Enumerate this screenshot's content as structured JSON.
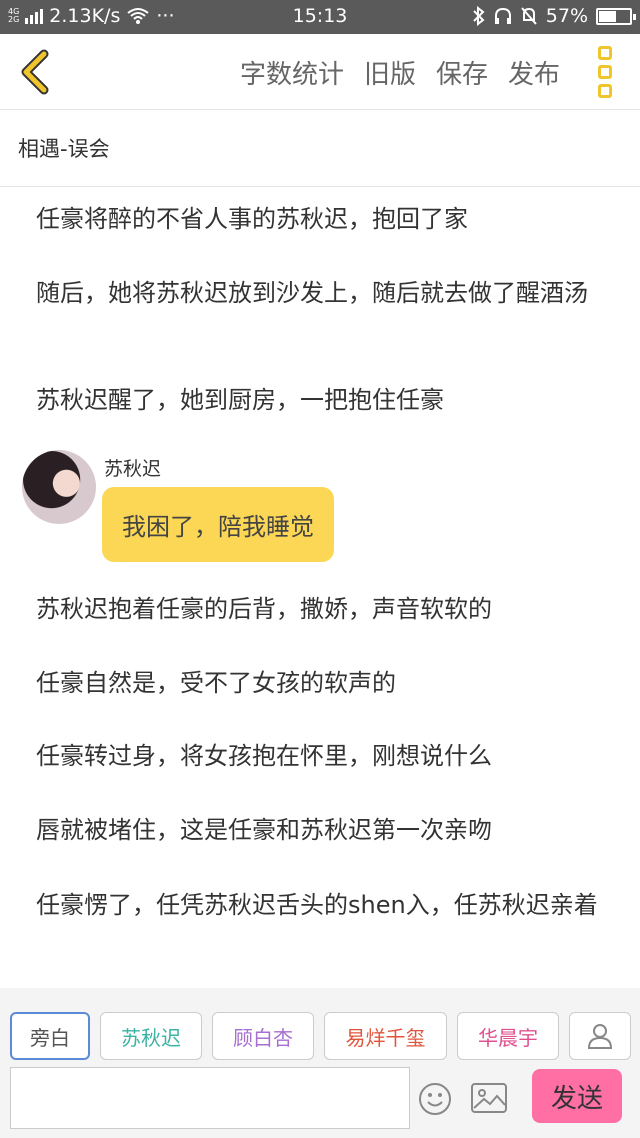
{
  "status": {
    "net_top": "4G",
    "net_bottom": "2G",
    "speed": "2.13K/s",
    "dots": "···",
    "time": "15:13",
    "battery": "57%",
    "battery_level": 0.57
  },
  "nav": {
    "word_count": "字数统计",
    "old_version": "旧版",
    "save": "保存",
    "publish": "发布"
  },
  "chapter_title": "相遇-误会",
  "content": {
    "p1": "任豪将醉的不省人事的苏秋迟，抱回了家",
    "p2": "随后，她将苏秋迟放到沙发上，随后就去做了醒酒汤",
    "p3": "苏秋迟醒了，她到厨房，一把抱住任豪",
    "dialog_speaker": "苏秋迟",
    "dialog_text": "我困了，陪我睡觉",
    "p4": "苏秋迟抱着任豪的后背，撒娇，声音软软的",
    "p5": "任豪自然是，受不了女孩的软声的",
    "p6": "任豪转过身，将女孩抱在怀里，刚想说什么",
    "p7": "唇就被堵住，这是任豪和苏秋迟第一次亲吻",
    "p8": "任豪愣了，任凭苏秋迟舌头的shen入，任苏秋迟亲着"
  },
  "roles": [
    {
      "label": "旁白",
      "color": "#555555"
    },
    {
      "label": "苏秋迟",
      "color": "#3bb3a3"
    },
    {
      "label": "顾白杏",
      "color": "#a66fd0"
    },
    {
      "label": "易烊千玺",
      "color": "#e0553c"
    },
    {
      "label": "华晨宇",
      "color": "#e0508f"
    }
  ],
  "send_label": "发送",
  "colors": {
    "accent_yellow": "#f0c42b",
    "bubble": "#fbd755",
    "send": "#ff6fa3"
  }
}
